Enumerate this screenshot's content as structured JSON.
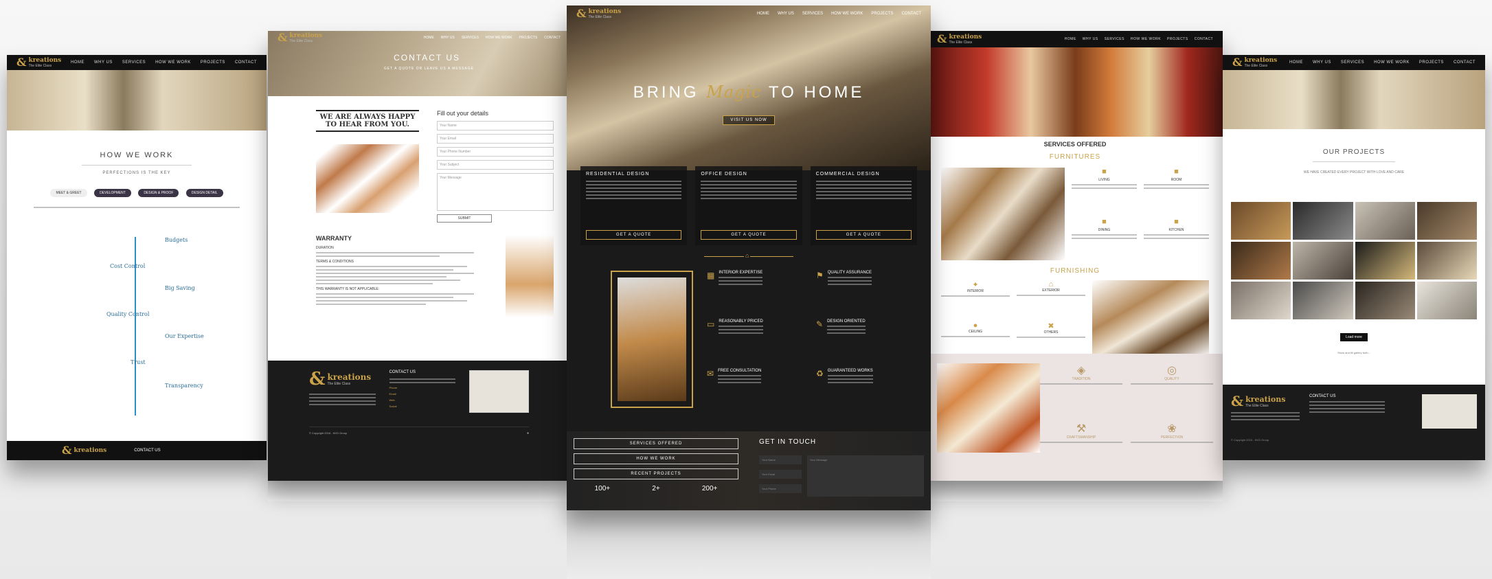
{
  "brand": {
    "name": "kreations",
    "tagline": "The Elite Class"
  },
  "nav": [
    "HOME",
    "WHY US",
    "SERVICES",
    "HOW WE WORK",
    "PROJECTS",
    "CONTACT"
  ],
  "p1": {
    "section_title": "HOW WE WORK",
    "subtitle": "PERFECTIONS IS THE KEY",
    "pills": [
      "MEET & GREET",
      "DEVELOPMENT",
      "DESIGN & PROOF",
      "DESIGN DETAIL"
    ],
    "steps": [
      "Budgets",
      "Cost Control",
      "Big Saving",
      "Quality Control",
      "Our Expertise",
      "Trust",
      "Transparency"
    ],
    "contact_label": "CONTACT US"
  },
  "p2": {
    "hero_title": "CONTACT US",
    "hero_sub": "GET A QUOTE OR LEAVE US A MESSAGE",
    "heading": "WE ARE ALWAYS HAPPY TO HEAR FROM YOU.",
    "form_title": "Fill out your details",
    "fields": [
      "Your Name",
      "Your Email",
      "Your Phone Number",
      "Your Subject",
      "Your Message"
    ],
    "submit": "SUBMIT",
    "warranty_title": "WARRANTY",
    "warranty_sub1": "DURATION",
    "warranty_sub2": "TERMS & CONDITIONS",
    "warranty_sub3": "THIS WARRANTY IS NOT APPLICABLE:",
    "footer_contact": "CONTACT US",
    "contact_rows": [
      "Phone",
      "Email",
      "Web",
      "Social"
    ],
    "copyright": "© Copyright 2016 - KKD Group"
  },
  "p3": {
    "hero_pre": "BRING",
    "hero_magic": "Magic",
    "hero_post": "TO HOME",
    "hero_btn": "VISIT US NOW",
    "cards": [
      {
        "title": "RESIDENTIAL DESIGN",
        "btn": "GET A QUOTE"
      },
      {
        "title": "OFFICE DESIGN",
        "btn": "GET A QUOTE"
      },
      {
        "title": "COMMERCIAL DESIGN",
        "btn": "GET A QUOTE"
      }
    ],
    "features": [
      {
        "title": "INTERIOR EXPERTISE",
        "icon": "layout-icon"
      },
      {
        "title": "QUALITY ASSURANCE",
        "icon": "trophy-icon"
      },
      {
        "title": "REASONABLY PRICED",
        "icon": "wallet-icon"
      },
      {
        "title": "DESIGN ORIENTED",
        "icon": "pencil-ruler-icon"
      },
      {
        "title": "FREE CONSULTATION",
        "icon": "chat-icon"
      },
      {
        "title": "GUARANTEED WORKS",
        "icon": "recycle-icon"
      }
    ],
    "bottom_btns": [
      "SERVICES OFFERED",
      "HOW WE WORK",
      "RECENT PROJECTS"
    ],
    "stats": [
      "100+",
      "2+",
      "200+"
    ],
    "get_in_touch": "GET IN TOUCH",
    "touch_fields": [
      "Your Name",
      "Your Message",
      "Your Email",
      "Your Phone"
    ]
  },
  "p4": {
    "title": "SERVICES OFFERED",
    "furnitures": "FURNITURES",
    "furn_items": [
      "LIVING",
      "ROOM",
      "DINING",
      "KITCHEN"
    ],
    "furnishing": "FURNISHING",
    "furnish_items": [
      "INTERIOR",
      "EXTERIOR",
      "CEILING",
      "OTHERS"
    ],
    "values": [
      "TRADITION",
      "QUALITY",
      "CRAFTSMANSHIP",
      "PERFECTION"
    ]
  },
  "p5": {
    "title": "OUR PROJECTS",
    "sub": "WE HAVE CREATED EVERY PROJECT WITH LOVE AND CARE",
    "load_more": "Load more",
    "more_text": "Show and fill gallery both...",
    "contact": "CONTACT US",
    "copyright": "© Copyright 2016 - KKD Group"
  },
  "colors": {
    "gold": "#c9a24a",
    "dark": "#111111",
    "panel_dark": "#1e1e1e"
  }
}
